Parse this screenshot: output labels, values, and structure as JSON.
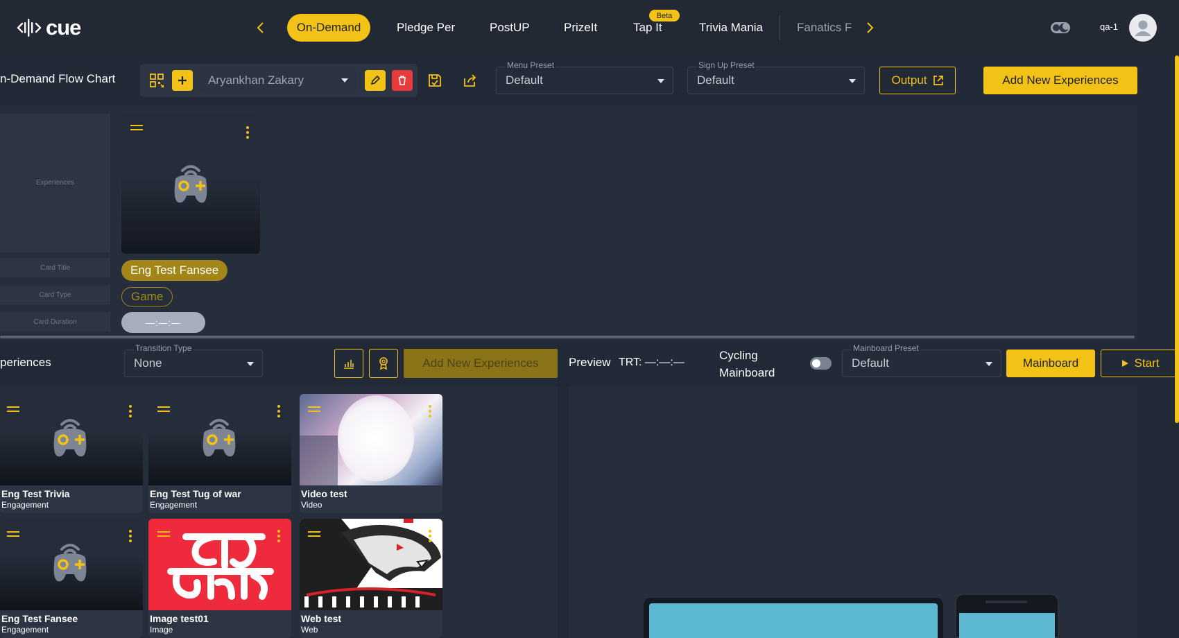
{
  "nav": {
    "tabs": [
      "On-Demand",
      "Pledge Per",
      "PostUP",
      "PrizeIt",
      "Tap It",
      "Trivia Mania",
      "Fanatics F"
    ],
    "beta_badge": "Beta",
    "user": "qa-1",
    "logo_text": "cue"
  },
  "toolbar": {
    "title": "n-Demand Flow Chart",
    "user_select": "Aryankhan Zakary",
    "menu_preset": {
      "label": "Menu Preset",
      "value": "Default"
    },
    "signup_preset": {
      "label": "Sign Up Preset",
      "value": "Default"
    },
    "output_label": "Output",
    "add_label": "Add New Experiences"
  },
  "flow": {
    "row_labels": [
      "Experiences",
      "Card Title",
      "Card Type",
      "Card Duration"
    ],
    "card": {
      "title": "Eng Test Fansee",
      "type": "Game",
      "duration": "—:—:—"
    }
  },
  "experiences": {
    "title": "periences",
    "transition": {
      "label": "Transition Type",
      "value": "None"
    },
    "add_label": "Add New Experiences",
    "preview_label": "Preview",
    "trt": "TRT: —:—:—",
    "cycling_line1": "Cycling",
    "cycling_line2": "Mainboard",
    "mainboard_preset": {
      "label": "Mainboard Preset",
      "value": "Default"
    },
    "mainboard_btn": "Mainboard",
    "start_btn": "Start",
    "cards": [
      {
        "title": "Eng Test Trivia",
        "sub": "Engagement"
      },
      {
        "title": "Eng Test Tug of war",
        "sub": "Engagement"
      },
      {
        "title": "Video test",
        "sub": "Video"
      },
      {
        "title": "Eng Test Fansee",
        "sub": "Engagement"
      },
      {
        "title": "Image test01",
        "sub": "Image"
      },
      {
        "title": "Web test",
        "sub": "Web"
      }
    ]
  },
  "colors": {
    "accent": "#f2c217",
    "bg": "#232a37",
    "panel": "#262d3b",
    "danger": "#e83a3a",
    "preview_screen": "#5bb8d0"
  }
}
